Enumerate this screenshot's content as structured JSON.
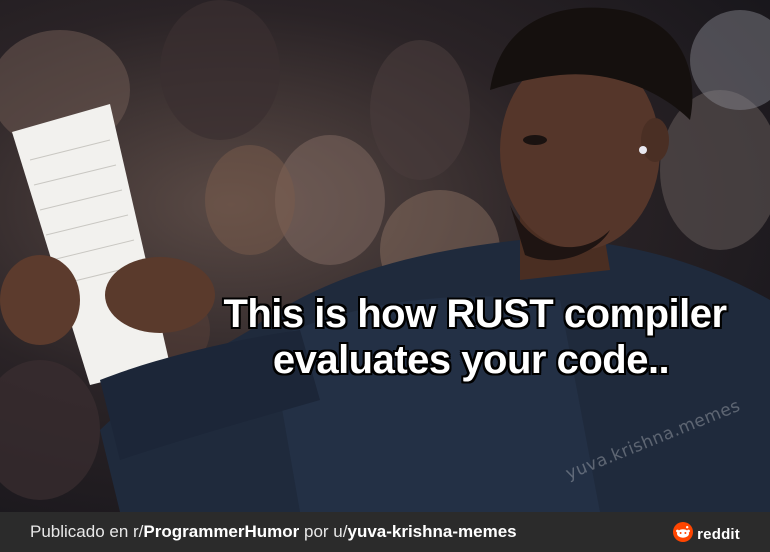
{
  "meme": {
    "caption_line1": "This is how RUST compiler",
    "caption_line2": "evaluates your code..",
    "watermark": "yuva.krishna.memes"
  },
  "footer": {
    "prefix": "Publicado en r/",
    "subreddit": "ProgrammerHumor",
    "middle": " por u/",
    "username": "yuva-krishna-memes",
    "brand": "reddit",
    "brand_icon": "reddit-alien-icon"
  },
  "colors": {
    "footer_bg": "#2b2b2b",
    "reddit_orange": "#ff4500",
    "caption_text": "#ffffff"
  }
}
